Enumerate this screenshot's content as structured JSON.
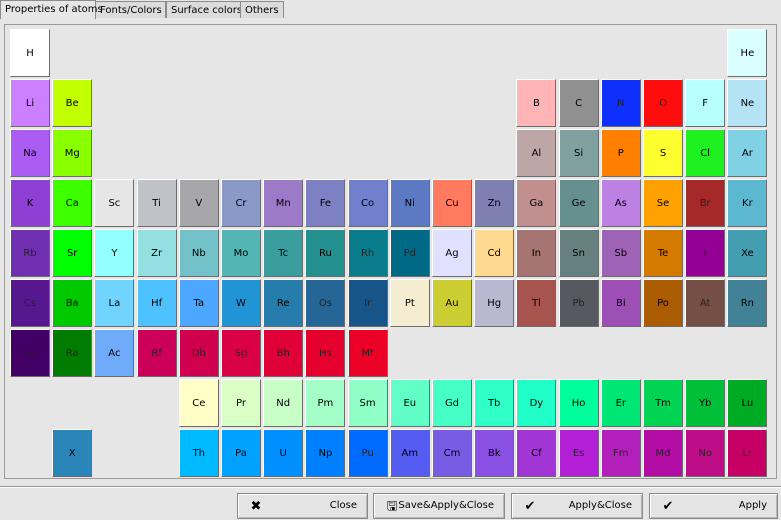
{
  "tabs": [
    "Properties of atoms",
    "Fonts/Colors",
    "Surface colors",
    "Others"
  ],
  "elements": [
    {
      "s": "H",
      "c": "#ffffff",
      "r": 1,
      "col": 1
    },
    {
      "s": "He",
      "c": "#d9ffff",
      "r": 1,
      "col": 18
    },
    {
      "s": "Li",
      "c": "#cc80ff",
      "r": 2,
      "col": 1
    },
    {
      "s": "Be",
      "c": "#c2ff00",
      "r": 2,
      "col": 2
    },
    {
      "s": "B",
      "c": "#ffb5b5",
      "r": 2,
      "col": 13
    },
    {
      "s": "C",
      "c": "#909090",
      "r": 2,
      "col": 14
    },
    {
      "s": "N",
      "c": "#0f2ffc",
      "r": 2,
      "col": 15
    },
    {
      "s": "O",
      "c": "#ff0d0d",
      "r": 2,
      "col": 16
    },
    {
      "s": "F",
      "c": "#b8ffff",
      "r": 2,
      "col": 17
    },
    {
      "s": "Ne",
      "c": "#b3e3f5",
      "r": 2,
      "col": 18
    },
    {
      "s": "Na",
      "c": "#ab5cf2",
      "r": 3,
      "col": 1
    },
    {
      "s": "Mg",
      "c": "#8aff00",
      "r": 3,
      "col": 2
    },
    {
      "s": "Al",
      "c": "#bfa6a6",
      "r": 3,
      "col": 13
    },
    {
      "s": "Si",
      "c": "#80a0a0",
      "r": 3,
      "col": 14
    },
    {
      "s": "P",
      "c": "#ff8000",
      "r": 3,
      "col": 15
    },
    {
      "s": "S",
      "c": "#ffff30",
      "r": 3,
      "col": 16
    },
    {
      "s": "Cl",
      "c": "#1ff01f",
      "r": 3,
      "col": 17
    },
    {
      "s": "Ar",
      "c": "#80d1e3",
      "r": 3,
      "col": 18
    },
    {
      "s": "K",
      "c": "#8f40d4",
      "r": 4,
      "col": 1
    },
    {
      "s": "Ca",
      "c": "#3dff00",
      "r": 4,
      "col": 2
    },
    {
      "s": "Sc",
      "c": "#e6e6e6",
      "r": 4,
      "col": 3
    },
    {
      "s": "Ti",
      "c": "#bfc2c7",
      "r": 4,
      "col": 4
    },
    {
      "s": "V",
      "c": "#a6a6ab",
      "r": 4,
      "col": 5
    },
    {
      "s": "Cr",
      "c": "#8a99c7",
      "r": 4,
      "col": 6
    },
    {
      "s": "Mn",
      "c": "#9c7ac7",
      "r": 4,
      "col": 7
    },
    {
      "s": "Fe",
      "c": "#7e80c4",
      "r": 4,
      "col": 8
    },
    {
      "s": "Co",
      "c": "#7080cc",
      "r": 4,
      "col": 9
    },
    {
      "s": "Ni",
      "c": "#5c7ac4",
      "r": 4,
      "col": 10
    },
    {
      "s": "Cu",
      "c": "#ff7a5f",
      "r": 4,
      "col": 11
    },
    {
      "s": "Zn",
      "c": "#7d80b0",
      "r": 4,
      "col": 12
    },
    {
      "s": "Ga",
      "c": "#c28f8f",
      "r": 4,
      "col": 13
    },
    {
      "s": "Ge",
      "c": "#668f8f",
      "r": 4,
      "col": 14
    },
    {
      "s": "As",
      "c": "#bd80e3",
      "r": 4,
      "col": 15
    },
    {
      "s": "Se",
      "c": "#ffa100",
      "r": 4,
      "col": 16
    },
    {
      "s": "Br",
      "c": "#a62929",
      "r": 4,
      "col": 17
    },
    {
      "s": "Kr",
      "c": "#5cb8d1",
      "r": 4,
      "col": 18
    },
    {
      "s": "Rb",
      "c": "#702eb0",
      "r": 5,
      "col": 1
    },
    {
      "s": "Sr",
      "c": "#00ff00",
      "r": 5,
      "col": 2
    },
    {
      "s": "Y",
      "c": "#94ffff",
      "r": 5,
      "col": 3
    },
    {
      "s": "Zr",
      "c": "#94e0e0",
      "r": 5,
      "col": 4
    },
    {
      "s": "Nb",
      "c": "#73c2c9",
      "r": 5,
      "col": 5
    },
    {
      "s": "Mo",
      "c": "#54b5b5",
      "r": 5,
      "col": 6
    },
    {
      "s": "Tc",
      "c": "#3b9e9e",
      "r": 5,
      "col": 7
    },
    {
      "s": "Ru",
      "c": "#248f8f",
      "r": 5,
      "col": 8
    },
    {
      "s": "Rh",
      "c": "#0a7d8c",
      "r": 5,
      "col": 9
    },
    {
      "s": "Pd",
      "c": "#006985",
      "r": 5,
      "col": 10
    },
    {
      "s": "Ag",
      "c": "#e0e0ff",
      "r": 5,
      "col": 11
    },
    {
      "s": "Cd",
      "c": "#ffd98f",
      "r": 5,
      "col": 12
    },
    {
      "s": "In",
      "c": "#a67573",
      "r": 5,
      "col": 13
    },
    {
      "s": "Sn",
      "c": "#668080",
      "r": 5,
      "col": 14
    },
    {
      "s": "Sb",
      "c": "#9e63b5",
      "r": 5,
      "col": 15
    },
    {
      "s": "Te",
      "c": "#d47a00",
      "r": 5,
      "col": 16
    },
    {
      "s": "I",
      "c": "#940094",
      "r": 5,
      "col": 17
    },
    {
      "s": "Xe",
      "c": "#429eb0",
      "r": 5,
      "col": 18
    },
    {
      "s": "Cs",
      "c": "#57178f",
      "r": 6,
      "col": 1
    },
    {
      "s": "Ba",
      "c": "#00c900",
      "r": 6,
      "col": 2
    },
    {
      "s": "La",
      "c": "#70d4ff",
      "r": 6,
      "col": 3
    },
    {
      "s": "Hf",
      "c": "#4dc2ff",
      "r": 6,
      "col": 4
    },
    {
      "s": "Ta",
      "c": "#4da6ff",
      "r": 6,
      "col": 5
    },
    {
      "s": "W",
      "c": "#2194d6",
      "r": 6,
      "col": 6
    },
    {
      "s": "Re",
      "c": "#267dab",
      "r": 6,
      "col": 7
    },
    {
      "s": "Os",
      "c": "#266696",
      "r": 6,
      "col": 8
    },
    {
      "s": "Ir",
      "c": "#175487",
      "r": 6,
      "col": 9
    },
    {
      "s": "Pt",
      "c": "#f5edd1",
      "r": 6,
      "col": 10
    },
    {
      "s": "Au",
      "c": "#cccc33",
      "r": 6,
      "col": 11
    },
    {
      "s": "Hg",
      "c": "#b8b8d0",
      "r": 6,
      "col": 12
    },
    {
      "s": "Tl",
      "c": "#a6544d",
      "r": 6,
      "col": 13
    },
    {
      "s": "Pb",
      "c": "#575961",
      "r": 6,
      "col": 14
    },
    {
      "s": "Bi",
      "c": "#9e4fb5",
      "r": 6,
      "col": 15
    },
    {
      "s": "Po",
      "c": "#ab5c00",
      "r": 6,
      "col": 16
    },
    {
      "s": "At",
      "c": "#754f45",
      "r": 6,
      "col": 17
    },
    {
      "s": "Rn",
      "c": "#428296",
      "r": 6,
      "col": 18
    },
    {
      "s": "Fr",
      "c": "#420066",
      "r": 7,
      "col": 1
    },
    {
      "s": "Ra",
      "c": "#007d00",
      "r": 7,
      "col": 2
    },
    {
      "s": "Ac",
      "c": "#70abfa",
      "r": 7,
      "col": 3
    },
    {
      "s": "Rf",
      "c": "#cc0059",
      "r": 7,
      "col": 4
    },
    {
      "s": "Db",
      "c": "#d1004f",
      "r": 7,
      "col": 5
    },
    {
      "s": "Sg",
      "c": "#d90045",
      "r": 7,
      "col": 6
    },
    {
      "s": "Bh",
      "c": "#e00038",
      "r": 7,
      "col": 7
    },
    {
      "s": "Hs",
      "c": "#e6002e",
      "r": 7,
      "col": 8
    },
    {
      "s": "Mt",
      "c": "#eb0026",
      "r": 7,
      "col": 9
    },
    {
      "s": "Ce",
      "c": "#ffffc7",
      "r": 8,
      "col": 5
    },
    {
      "s": "Pr",
      "c": "#d9ffc7",
      "r": 8,
      "col": 6
    },
    {
      "s": "Nd",
      "c": "#c7ffc7",
      "r": 8,
      "col": 7
    },
    {
      "s": "Pm",
      "c": "#a3ffc7",
      "r": 8,
      "col": 8
    },
    {
      "s": "Sm",
      "c": "#8fffc7",
      "r": 8,
      "col": 9
    },
    {
      "s": "Eu",
      "c": "#61ffc7",
      "r": 8,
      "col": 10
    },
    {
      "s": "Gd",
      "c": "#45ffc7",
      "r": 8,
      "col": 11
    },
    {
      "s": "Tb",
      "c": "#30ffc7",
      "r": 8,
      "col": 12
    },
    {
      "s": "Dy",
      "c": "#1fffc7",
      "r": 8,
      "col": 13
    },
    {
      "s": "Ho",
      "c": "#00ff9c",
      "r": 8,
      "col": 14
    },
    {
      "s": "Er",
      "c": "#00e675",
      "r": 8,
      "col": 15
    },
    {
      "s": "Tm",
      "c": "#00d452",
      "r": 8,
      "col": 16
    },
    {
      "s": "Yb",
      "c": "#00bf38",
      "r": 8,
      "col": 17
    },
    {
      "s": "Lu",
      "c": "#00ab24",
      "r": 8,
      "col": 18
    },
    {
      "s": "X",
      "c": "#2a85b8",
      "r": 9,
      "col": 2
    },
    {
      "s": "Th",
      "c": "#00baff",
      "r": 9,
      "col": 5
    },
    {
      "s": "Pa",
      "c": "#00a1ff",
      "r": 9,
      "col": 6
    },
    {
      "s": "U",
      "c": "#008fff",
      "r": 9,
      "col": 7
    },
    {
      "s": "Np",
      "c": "#0080ff",
      "r": 9,
      "col": 8
    },
    {
      "s": "Pu",
      "c": "#006bff",
      "r": 9,
      "col": 9
    },
    {
      "s": "Am",
      "c": "#545cf2",
      "r": 9,
      "col": 10
    },
    {
      "s": "Cm",
      "c": "#785ce3",
      "r": 9,
      "col": 11
    },
    {
      "s": "Bk",
      "c": "#8a4fe3",
      "r": 9,
      "col": 12
    },
    {
      "s": "Cf",
      "c": "#a136d4",
      "r": 9,
      "col": 13
    },
    {
      "s": "Es",
      "c": "#b31fd4",
      "r": 9,
      "col": 14
    },
    {
      "s": "Fm",
      "c": "#b31fba",
      "r": 9,
      "col": 15
    },
    {
      "s": "Md",
      "c": "#b30da6",
      "r": 9,
      "col": 16
    },
    {
      "s": "No",
      "c": "#bd0d87",
      "r": 9,
      "col": 17
    },
    {
      "s": "Lr",
      "c": "#c70066",
      "r": 9,
      "col": 18
    }
  ],
  "buttons": [
    {
      "label": "Close",
      "icon": "close-icon",
      "glyph": "✖"
    },
    {
      "label": "Save&Apply&Close",
      "icon": "save-icon",
      "glyph": "🖫"
    },
    {
      "label": "Apply&Close",
      "icon": "check-icon",
      "glyph": "✔"
    },
    {
      "label": "Apply",
      "icon": "check-icon",
      "glyph": "✔"
    }
  ]
}
